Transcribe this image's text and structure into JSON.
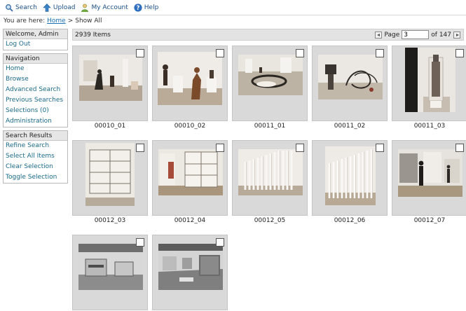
{
  "toolbar": {
    "search_label": "Search",
    "upload_label": "Upload",
    "account_label": "My Account",
    "help_label": "Help"
  },
  "breadcrumb": {
    "prefix": "You are here:",
    "home": "Home",
    "separator": ">",
    "current": "Show All"
  },
  "sidebar": {
    "welcome": {
      "title": "Welcome, Admin",
      "items": [
        "Log Out"
      ]
    },
    "navigation": {
      "title": "Navigation",
      "items": [
        "Home",
        "Browse",
        "Advanced Search",
        "Previous Searches",
        "Selections (0)",
        "Administration"
      ]
    },
    "results": {
      "title": "Search Results",
      "items": [
        "Refine Search",
        "Select All Items",
        "Clear Selection",
        "Toggle Selection"
      ]
    }
  },
  "results": {
    "count": "2939 Items",
    "page_label": "Page",
    "page_value": "3",
    "of_label": "of 147"
  },
  "thumbnails": [
    {
      "caption": "00010_01",
      "checked": false
    },
    {
      "caption": "00010_02",
      "checked": false
    },
    {
      "caption": "00011_01",
      "checked": false
    },
    {
      "caption": "00011_02",
      "checked": false
    },
    {
      "caption": "00011_03",
      "checked": false
    },
    {
      "caption": "00012_03",
      "checked": false
    },
    {
      "caption": "00012_04",
      "checked": false
    },
    {
      "caption": "00012_05",
      "checked": false
    },
    {
      "caption": "00012_06",
      "checked": false
    },
    {
      "caption": "00012_07",
      "checked": false
    },
    {
      "caption": "",
      "checked": false
    },
    {
      "caption": "",
      "checked": false
    }
  ],
  "colors": {
    "link": "#1a6a8a",
    "toolbar_link": "#1a4f86",
    "thumb_bg": "#d9d9d9",
    "header_bg": "#e3e3e3"
  }
}
